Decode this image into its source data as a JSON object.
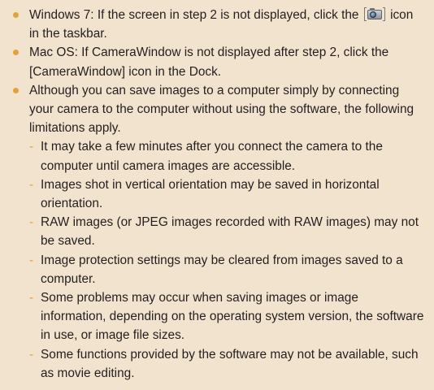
{
  "notes": {
    "item1": {
      "before_icon": "Windows 7: If the screen in step 2 is not displayed, click the",
      "icon": "camerawindow-taskbar-icon",
      "after_icon": "icon in the taskbar."
    },
    "item2": "Mac OS: If CameraWindow is not displayed after step 2, click the [CameraWindow] icon in the Dock.",
    "item3": "Although you can save images to a computer simply by connecting your camera to the computer without using the software, the following limitations apply.",
    "limitations": [
      "It may take a few minutes after you connect the camera to the computer until camera images are accessible.",
      "Images shot in vertical orientation may be saved in horizontal orientation.",
      "RAW images (or JPEG images recorded with RAW images) may not be saved.",
      "Image protection settings may be cleared from images saved to a computer.",
      "Some problems may occur when saving images or image information, depending on the operating system version, the software in use, or image file sizes.",
      "Some functions provided by the software may not be available, such as movie editing."
    ],
    "dash": "-"
  },
  "colors": {
    "background": "#f2e3ce",
    "bullet": "#e3a23a",
    "text": "#231f20"
  }
}
